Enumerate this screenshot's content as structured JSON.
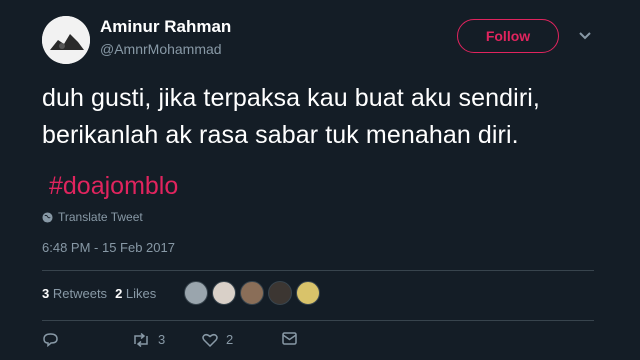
{
  "user": {
    "name": "Aminur Rahman",
    "handle": "@AmnrMohammad"
  },
  "follow_label": "Follow",
  "tweet": {
    "line1": "duh gusti, jika terpaksa kau buat aku sendiri,",
    "line2": "berikanlah ak rasa sabar tuk menahan diri.",
    "hashtag": "#doajomblo"
  },
  "translate_label": "Translate Tweet",
  "timestamp": "6:48 PM - 15 Feb 2017",
  "stats": {
    "retweets_count": "3",
    "retweets_label": "Retweets",
    "likes_count": "2",
    "likes_label": "Likes"
  },
  "actions": {
    "retweet_count": "3",
    "like_count": "2"
  },
  "colors": {
    "background": "#141d26",
    "accent": "#e0245e",
    "muted": "#8899a6"
  },
  "icons": [
    "globe-icon",
    "chevron-down-icon",
    "reply-icon",
    "retweet-icon",
    "heart-icon",
    "message-icon"
  ]
}
